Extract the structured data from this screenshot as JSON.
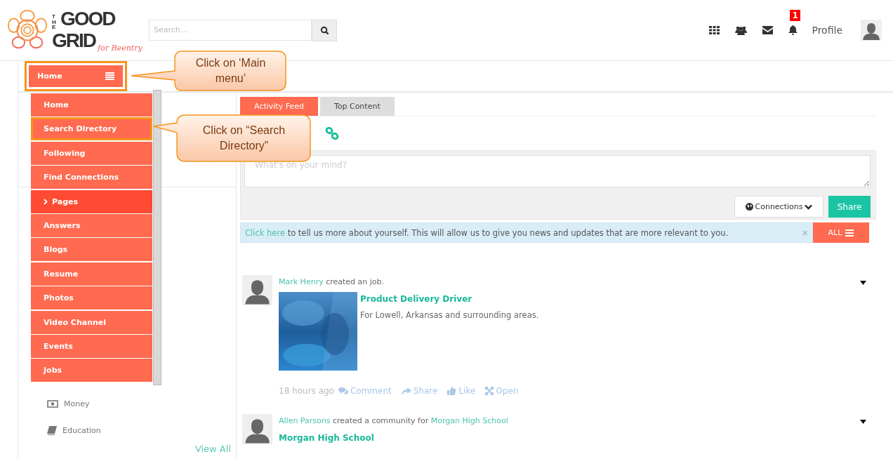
{
  "logo": {
    "small": "THE",
    "line1": "GOOD",
    "line2": "GRID",
    "tagline": "for Reentry"
  },
  "search": {
    "placeholder": "Search..."
  },
  "header": {
    "badge": "1",
    "profile": "Profile"
  },
  "menu_button": {
    "label": "Home",
    "highlighted": true
  },
  "main_menu": [
    {
      "label": "Home",
      "selected": false,
      "highlighted": false
    },
    {
      "label": "Search Directory",
      "selected": false,
      "highlighted": true
    },
    {
      "label": "Following",
      "selected": false,
      "highlighted": false
    },
    {
      "label": "Find Connections",
      "selected": false,
      "highlighted": false
    },
    {
      "label": "Pages",
      "selected": true,
      "highlighted": false
    },
    {
      "label": "Answers",
      "selected": false,
      "highlighted": false
    },
    {
      "label": "Blogs",
      "selected": false,
      "highlighted": false
    },
    {
      "label": "Resume",
      "selected": false,
      "highlighted": false
    },
    {
      "label": "Photos",
      "selected": false,
      "highlighted": false
    },
    {
      "label": "Video Channel",
      "selected": false,
      "highlighted": false
    },
    {
      "label": "Events",
      "selected": false,
      "highlighted": false
    },
    {
      "label": "Jobs",
      "selected": false,
      "highlighted": false
    }
  ],
  "callouts": [
    {
      "text": "Click on ‘Main menu’"
    },
    {
      "text": "Click on “Search Directory”"
    }
  ],
  "sidebar": {
    "links": [
      {
        "label": "Money",
        "kind": "money"
      },
      {
        "label": "Education",
        "kind": "book"
      }
    ],
    "view_all": "View All"
  },
  "tabs": [
    {
      "label": "Activity Feed",
      "selected": true
    },
    {
      "label": "Top Content",
      "selected": false
    }
  ],
  "composer": {
    "placeholder": "What's on your mind?",
    "privacy": "Connections",
    "share": "Share"
  },
  "notice": {
    "link": "Click here",
    "text": " to tell us more about yourself. This will allow us to give you news and updates that are more relevant to you.",
    "close": "×",
    "filter": "ALL"
  },
  "posts": [
    {
      "actor": "Mark Henry",
      "action": "created an job.",
      "title": "Product Delivery Driver",
      "description": "For Lowell, Arkansas and surrounding areas.",
      "kind": "picture",
      "time": "18 hours ago",
      "actions": [
        "Comment",
        "Share",
        "Like",
        "Open"
      ]
    },
    {
      "actor": "Allen Parsons",
      "action": "created a community for",
      "target": "Morgan High School",
      "title": "Morgan High School"
    }
  ]
}
